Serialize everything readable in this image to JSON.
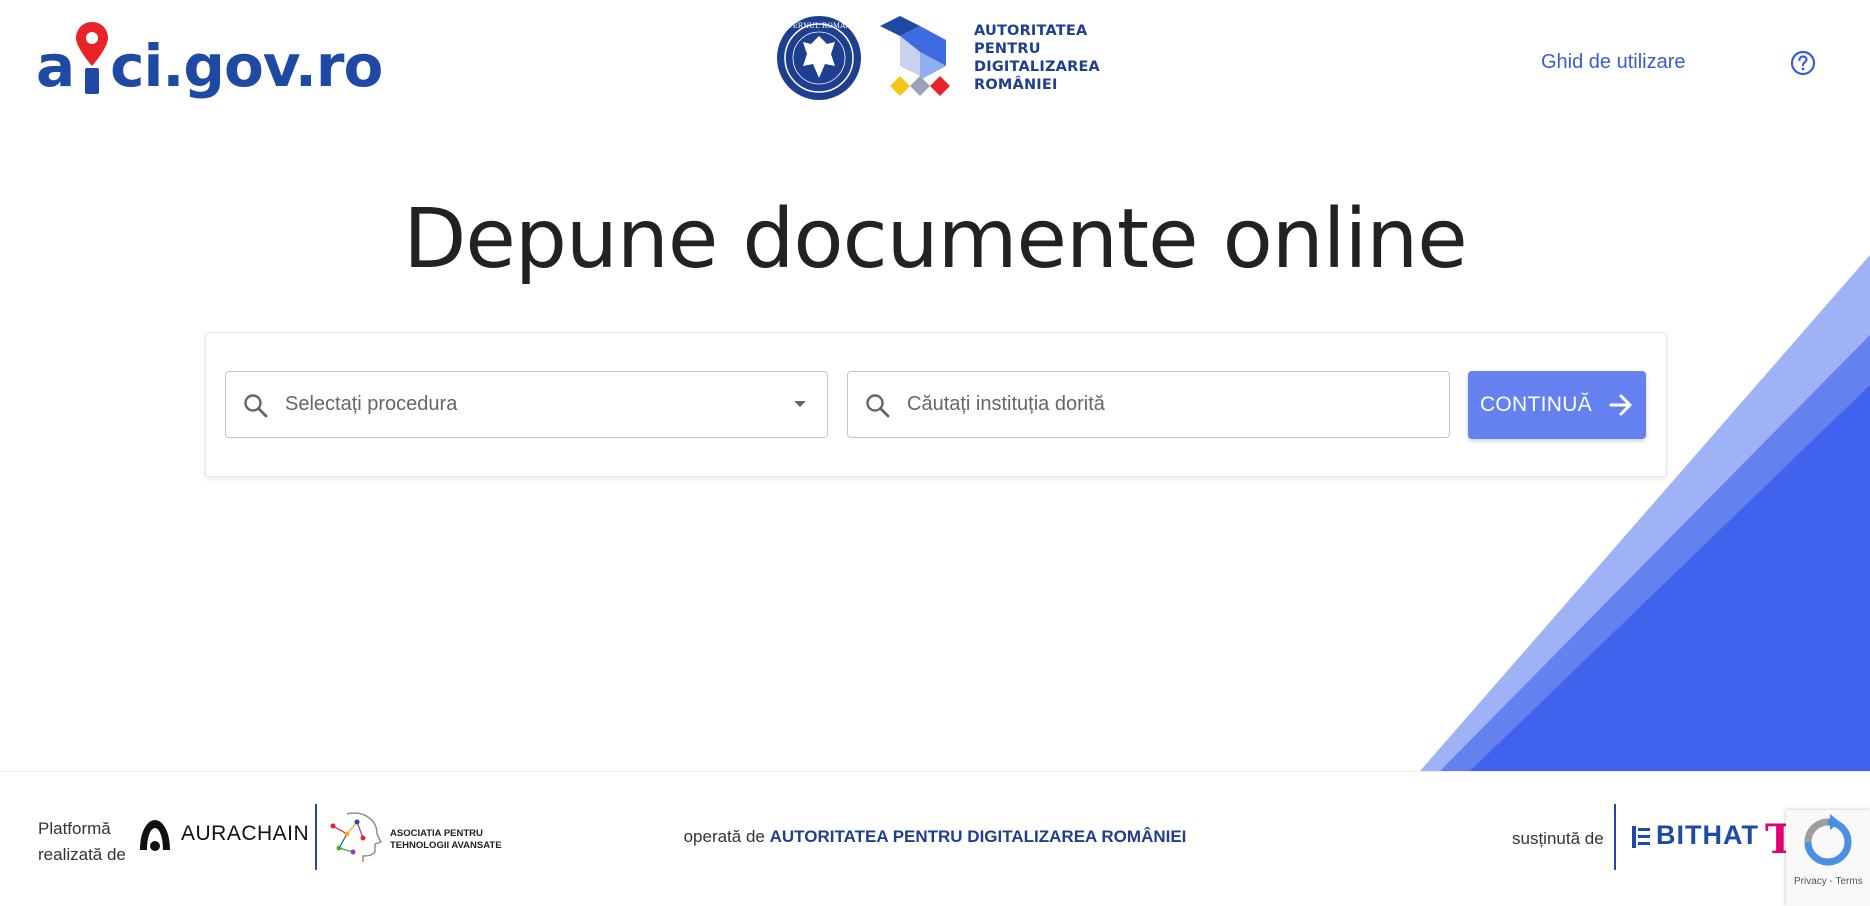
{
  "header": {
    "logo_text_pre": "a",
    "logo_text_post": "ci.gov.ro",
    "gov_seal_text": "GUVERNUL ROMÂNIEI",
    "authority_lines": [
      "AUTORITATEA",
      "PENTRU",
      "DIGITALIZAREA",
      "ROMÂNIEI"
    ],
    "guide_link": "Ghid de utilizare",
    "help_icon": "help-circle-icon"
  },
  "hero": {
    "title": "Depune documente online"
  },
  "search": {
    "procedure_placeholder": "Selectați procedura",
    "institution_placeholder": "Căutați instituția dorită",
    "continue_label": "CONTINUĂ",
    "search_icon": "search-icon",
    "dropdown_icon": "caret-down-icon",
    "continue_icon": "arrow-right-icon"
  },
  "footer": {
    "made_by_line1": "Platformă",
    "made_by_line2": "realizată de",
    "partner1_name": "AURACHAIN",
    "partner2_lines": [
      "ASOCIATIA PENTRU",
      "TEHNOLOGII AVANSATE"
    ],
    "operated_prefix": "operată de",
    "operated_by": "AUTORITATEA PENTRU DIGITALIZAREA ROMÂNIEI",
    "supported_label": "susținută de",
    "sponsor1": "BITHAT",
    "sponsor2": "T",
    "recaptcha_text": "Privacy - Terms"
  },
  "colors": {
    "brand_blue": "#1e4aa6",
    "accent": "#6581f0",
    "decor_light": "#9fb2f5",
    "decor_dark": "#3f63ec",
    "pin_red": "#e8232a",
    "telekom_magenta": "#e20074"
  }
}
